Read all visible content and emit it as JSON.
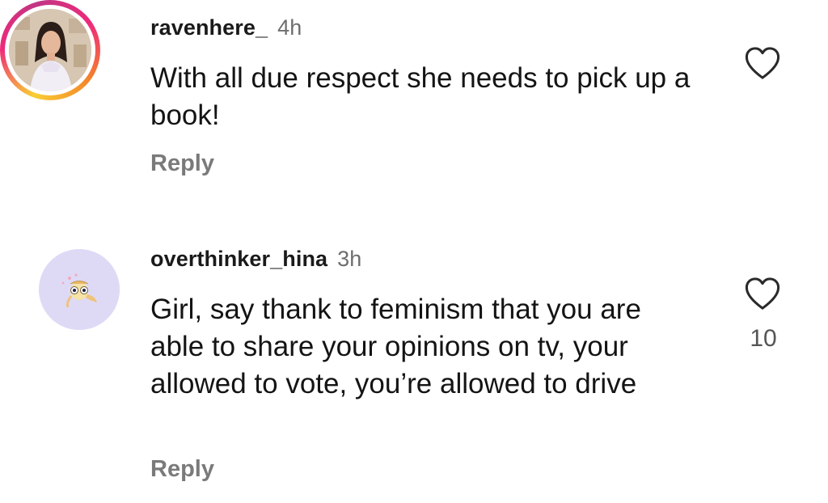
{
  "comments": [
    {
      "username": "ravenhere_",
      "time": "4h",
      "text": "With all due respect she needs to pick up a book!",
      "reply_label": "Reply",
      "like_count": "",
      "has_story_ring": true
    },
    {
      "username": "overthinker_hina",
      "time": "3h",
      "text": "Girl, say thank to feminism that you are able to share your opinions on tv, your allowed to vote, you’re allowed to drive",
      "reply_label": "Reply",
      "like_count": "10",
      "has_story_ring": false
    }
  ],
  "icons": {
    "like": "heart-outline-icon"
  },
  "colors": {
    "story_ring_start": "#f9ce34",
    "story_ring_mid": "#ee2a7b",
    "story_ring_end": "#c13584",
    "avatar2_bg": "#dedaf6",
    "secondary_text": "#6e6e6e"
  }
}
